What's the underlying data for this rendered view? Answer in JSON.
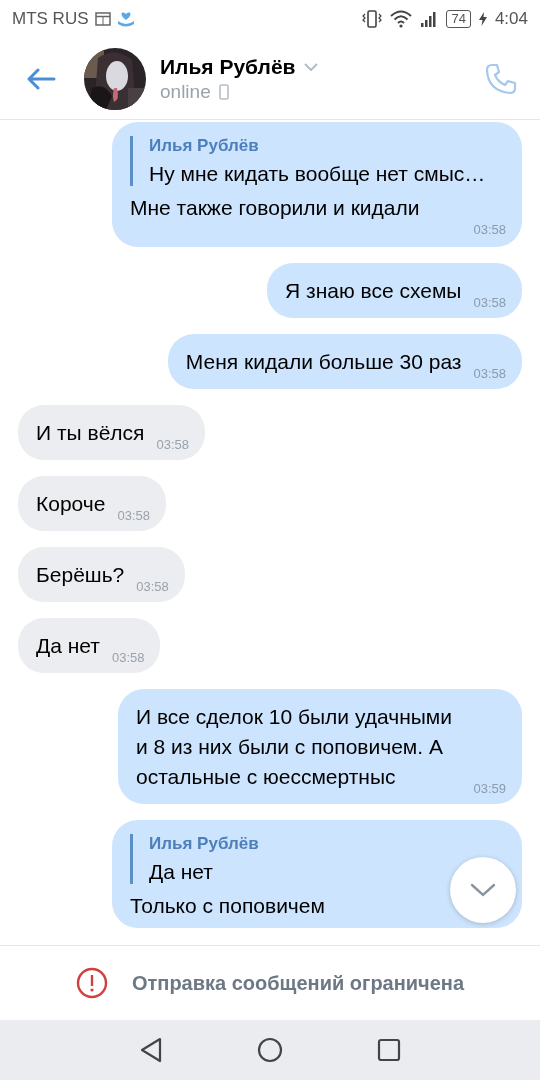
{
  "status_bar": {
    "carrier": "MTS RUS",
    "battery": "74",
    "time": "4:04"
  },
  "header": {
    "name": "Илья Рублёв",
    "status": "online"
  },
  "messages": [
    {
      "kind": "out",
      "reply": {
        "author": "Илья Рублёв",
        "text": "Ну мне кидать вообще нет смыс…"
      },
      "text": "Мне также говорили и кидали",
      "time": "03:58"
    },
    {
      "kind": "out",
      "text": "Я знаю все схемы",
      "time": "03:58"
    },
    {
      "kind": "out",
      "text": "Меня кидали больше 30 раз",
      "time": "03:58"
    },
    {
      "kind": "in",
      "text": "И ты вёлся",
      "time": "03:58"
    },
    {
      "kind": "in",
      "text": "Короче",
      "time": "03:58"
    },
    {
      "kind": "in",
      "text": "Берёшь?",
      "time": "03:58"
    },
    {
      "kind": "in",
      "text": "Да нет",
      "time": "03:58"
    },
    {
      "kind": "out",
      "text": "И все сделок 10 были удачными и 8 из них были с поповичем. А остальные с юессмертныс",
      "time": "03:59"
    },
    {
      "kind": "out",
      "reply": {
        "author": "Илья Рублёв",
        "text": "Да нет"
      },
      "text": "Только с поповичем"
    }
  ],
  "notice": "Отправка сообщений ограничена"
}
